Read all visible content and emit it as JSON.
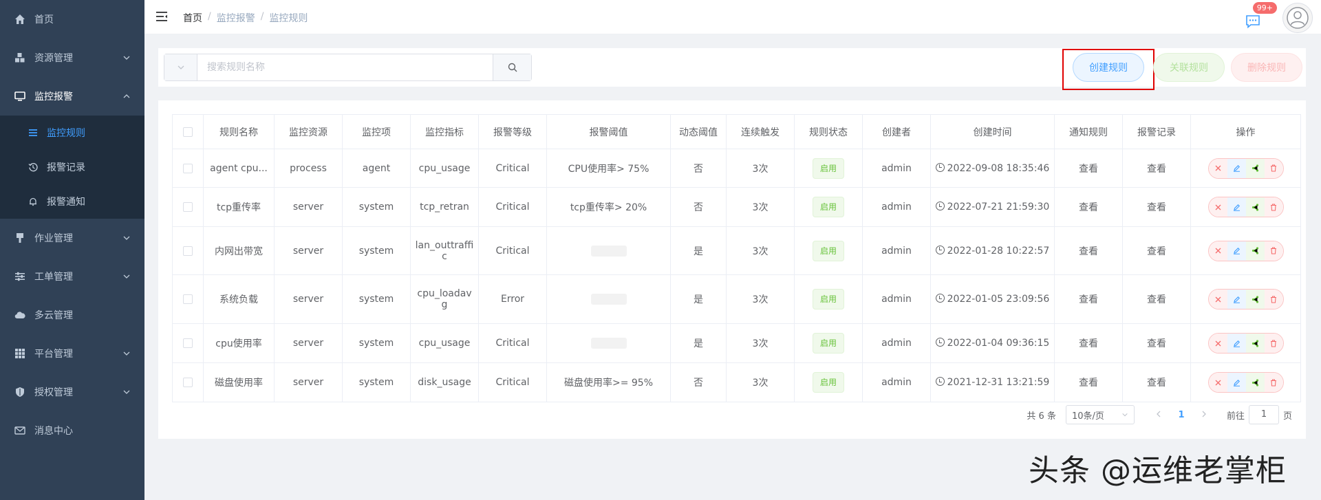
{
  "sidebar": {
    "items": [
      {
        "label": "首页",
        "icon": "home-icon",
        "has_children": false
      },
      {
        "label": "资源管理",
        "icon": "cubes-icon",
        "has_children": true
      },
      {
        "label": "监控报警",
        "icon": "monitor-icon",
        "has_children": true,
        "expanded": true,
        "children": [
          {
            "label": "监控规则",
            "icon": "list-icon",
            "active": true
          },
          {
            "label": "报警记录",
            "icon": "history-icon"
          },
          {
            "label": "报警通知",
            "icon": "bell-icon"
          }
        ]
      },
      {
        "label": "作业管理",
        "icon": "task-icon",
        "has_children": true
      },
      {
        "label": "工单管理",
        "icon": "sliders-icon",
        "has_children": true
      },
      {
        "label": "多云管理",
        "icon": "cloud-icon",
        "has_children": false
      },
      {
        "label": "平台管理",
        "icon": "grid-icon",
        "has_children": true
      },
      {
        "label": "授权管理",
        "icon": "shield-icon",
        "has_children": true
      },
      {
        "label": "消息中心",
        "icon": "mail-icon",
        "has_children": false
      }
    ]
  },
  "header": {
    "breadcrumb": [
      "首页",
      "监控报警",
      "监控规则"
    ],
    "badge": "99+"
  },
  "toolbar": {
    "search_placeholder": "搜索规则名称",
    "create_label": "创建规则",
    "link_label": "关联规则",
    "delete_label": "删除规则"
  },
  "table": {
    "columns": [
      "规则名称",
      "监控资源",
      "监控项",
      "监控指标",
      "报警等级",
      "报警阈值",
      "动态阈值",
      "连续触发",
      "规则状态",
      "创建者",
      "创建时间",
      "通知规则",
      "报警记录",
      "操作"
    ],
    "rows": [
      {
        "name": "agent cpu...",
        "resource": "process",
        "item": "agent",
        "metric": "cpu_usage",
        "level": "Critical",
        "threshold": "CPU使用率> 75%",
        "dynamic": "否",
        "trigger": "3次",
        "status": "启用",
        "creator": "admin",
        "created": "2022-09-08 18:35:46",
        "notify": "查看",
        "record": "查看"
      },
      {
        "name": "tcp重传率",
        "resource": "server",
        "item": "system",
        "metric": "tcp_retran",
        "level": "Critical",
        "threshold": "tcp重传率> 20%",
        "dynamic": "否",
        "trigger": "3次",
        "status": "启用",
        "creator": "admin",
        "created": "2022-07-21 21:59:30",
        "notify": "查看",
        "record": "查看"
      },
      {
        "name": "内网出带宽",
        "resource": "server",
        "item": "system",
        "metric": "lan_outtraffic",
        "level": "Critical",
        "threshold": "",
        "dynamic": "是",
        "trigger": "3次",
        "status": "启用",
        "creator": "admin",
        "created": "2022-01-28 10:22:57",
        "notify": "查看",
        "record": "查看"
      },
      {
        "name": "系统负载",
        "resource": "server",
        "item": "system",
        "metric": "cpu_loadavg",
        "level": "Error",
        "threshold": "",
        "dynamic": "是",
        "trigger": "3次",
        "status": "启用",
        "creator": "admin",
        "created": "2022-01-05 23:09:56",
        "notify": "查看",
        "record": "查看"
      },
      {
        "name": "cpu使用率",
        "resource": "server",
        "item": "system",
        "metric": "cpu_usage",
        "level": "Critical",
        "threshold": "",
        "dynamic": "是",
        "trigger": "3次",
        "status": "启用",
        "creator": "admin",
        "created": "2022-01-04 09:36:15",
        "notify": "查看",
        "record": "查看"
      },
      {
        "name": "磁盘使用率",
        "resource": "server",
        "item": "system",
        "metric": "disk_usage",
        "level": "Critical",
        "threshold": "磁盘使用率>= 95%",
        "dynamic": "否",
        "trigger": "3次",
        "status": "启用",
        "creator": "admin",
        "created": "2021-12-31 13:21:59",
        "notify": "查看",
        "record": "查看"
      }
    ]
  },
  "pagination": {
    "total": "共 6 条",
    "page_size": "10条/页",
    "current": "1",
    "goto_prefix": "前往",
    "goto_value": "1",
    "goto_suffix": "页"
  },
  "watermark": "头条 @运维老掌柜"
}
